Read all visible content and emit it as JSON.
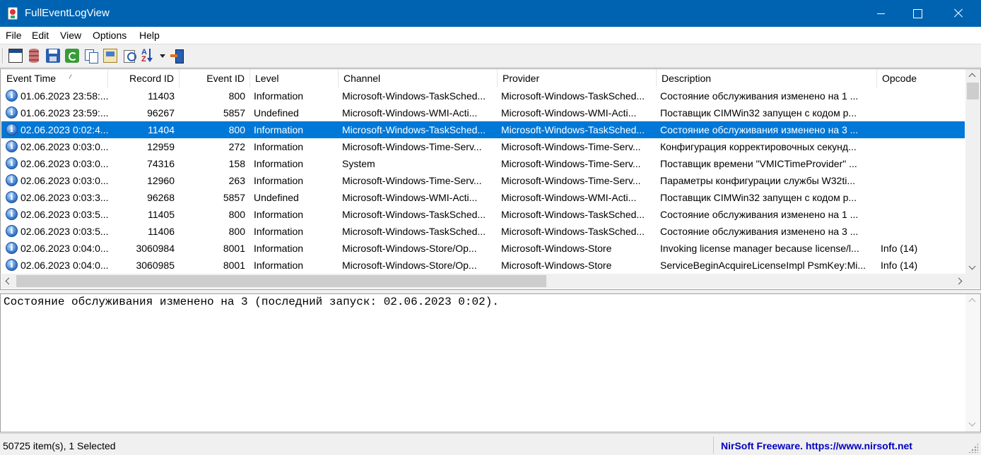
{
  "window": {
    "title": "FullEventLogView"
  },
  "menu": [
    "File",
    "Edit",
    "View",
    "Options",
    "Help"
  ],
  "toolbar": {
    "buttons": [
      {
        "icon": "properties-icon"
      },
      {
        "icon": "database-icon"
      },
      {
        "icon": "save-icon"
      },
      {
        "icon": "refresh-icon"
      },
      {
        "icon": "copy-icon"
      },
      {
        "icon": "html-report-icon"
      },
      {
        "icon": "find-icon"
      },
      {
        "icon": "sort-icon"
      },
      {
        "icon": "exit-icon"
      }
    ]
  },
  "columns": [
    "Event Time",
    "Record ID",
    "Event ID",
    "Level",
    "Channel",
    "Provider",
    "Description",
    "Opcode"
  ],
  "rows": [
    {
      "time": "01.06.2023 23:58:...",
      "record": "11403",
      "event": "800",
      "level": "Information",
      "channel": "Microsoft-Windows-TaskSched...",
      "provider": "Microsoft-Windows-TaskSched...",
      "desc": "Состояние обслуживания изменено на 1 ...",
      "opcode": ""
    },
    {
      "time": "01.06.2023 23:59:...",
      "record": "96267",
      "event": "5857",
      "level": "Undefined",
      "channel": "Microsoft-Windows-WMI-Acti...",
      "provider": "Microsoft-Windows-WMI-Acti...",
      "desc": "Поставщик CIMWin32 запущен с кодом р...",
      "opcode": ""
    },
    {
      "time": "02.06.2023 0:02:4...",
      "record": "11404",
      "event": "800",
      "level": "Information",
      "channel": "Microsoft-Windows-TaskSched...",
      "provider": "Microsoft-Windows-TaskSched...",
      "desc": "Состояние обслуживания изменено на 3 ...",
      "opcode": "",
      "selected": true
    },
    {
      "time": "02.06.2023 0:03:0...",
      "record": "12959",
      "event": "272",
      "level": "Information",
      "channel": "Microsoft-Windows-Time-Serv...",
      "provider": "Microsoft-Windows-Time-Serv...",
      "desc": "Конфигурация корректировочных секунд...",
      "opcode": ""
    },
    {
      "time": "02.06.2023 0:03:0...",
      "record": "74316",
      "event": "158",
      "level": "Information",
      "channel": "System",
      "provider": "Microsoft-Windows-Time-Serv...",
      "desc": "Поставщик времени \"VMICTimeProvider\" ...",
      "opcode": ""
    },
    {
      "time": "02.06.2023 0:03:0...",
      "record": "12960",
      "event": "263",
      "level": "Information",
      "channel": "Microsoft-Windows-Time-Serv...",
      "provider": "Microsoft-Windows-Time-Serv...",
      "desc": "Параметры конфигурации службы W32ti...",
      "opcode": ""
    },
    {
      "time": "02.06.2023 0:03:3...",
      "record": "96268",
      "event": "5857",
      "level": "Undefined",
      "channel": "Microsoft-Windows-WMI-Acti...",
      "provider": "Microsoft-Windows-WMI-Acti...",
      "desc": "Поставщик CIMWin32 запущен с кодом р...",
      "opcode": ""
    },
    {
      "time": "02.06.2023 0:03:5...",
      "record": "11405",
      "event": "800",
      "level": "Information",
      "channel": "Microsoft-Windows-TaskSched...",
      "provider": "Microsoft-Windows-TaskSched...",
      "desc": "Состояние обслуживания изменено на 1 ...",
      "opcode": ""
    },
    {
      "time": "02.06.2023 0:03:5...",
      "record": "11406",
      "event": "800",
      "level": "Information",
      "channel": "Microsoft-Windows-TaskSched...",
      "provider": "Microsoft-Windows-TaskSched...",
      "desc": "Состояние обслуживания изменено на 3 ...",
      "opcode": ""
    },
    {
      "time": "02.06.2023 0:04:0...",
      "record": "3060984",
      "event": "8001",
      "level": "Information",
      "channel": "Microsoft-Windows-Store/Op...",
      "provider": "Microsoft-Windows-Store",
      "desc": "Invoking license manager because license/l...",
      "opcode": "Info (14)"
    },
    {
      "time": "02.06.2023 0:04:0...",
      "record": "3060985",
      "event": "8001",
      "level": "Information",
      "channel": "Microsoft-Windows-Store/Op...",
      "provider": "Microsoft-Windows-Store",
      "desc": "ServiceBeginAcquireLicenseImpl PsmKey:Mi...",
      "opcode": "Info (14)"
    }
  ],
  "details": {
    "text": "Состояние обслуживания изменено на 3 (последний запуск: 02.06.2023 0:02)."
  },
  "status": {
    "items": "50725 item(s), 1 Selected",
    "credit": "NirSoft Freeware. https://www.nirsoft.net"
  },
  "colors": {
    "titlebar": "#0063b1",
    "selection": "#0078d7",
    "credit_link": "#0000c0"
  }
}
